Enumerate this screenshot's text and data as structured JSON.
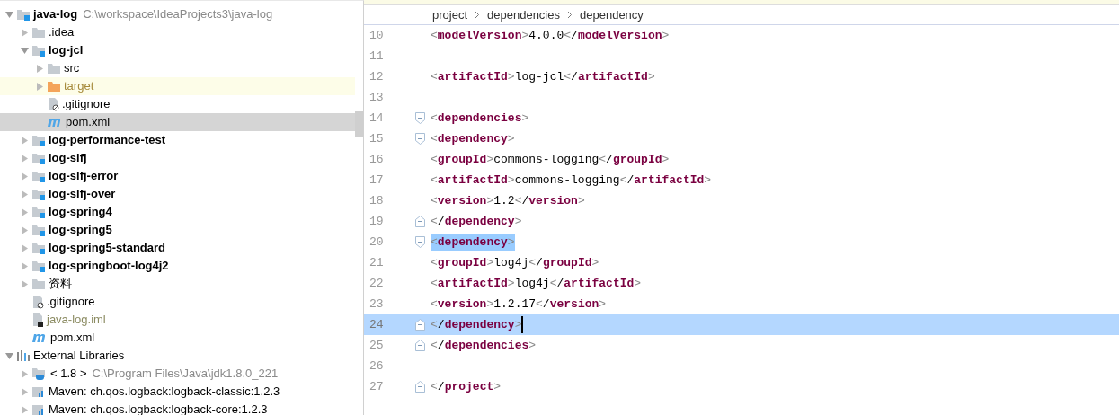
{
  "project_tree": [
    {
      "label": "java-log",
      "kind": "module",
      "bold": true,
      "path": "C:\\workspace\\IdeaProjects3\\java-log",
      "expanded": true,
      "selected": false,
      "children": [
        {
          "label": ".idea",
          "kind": "folder",
          "bold": false,
          "expanded": false,
          "selected": false
        },
        {
          "label": "log-jcl",
          "kind": "module",
          "bold": true,
          "expanded": true,
          "selected": false,
          "children": [
            {
              "label": "src",
              "kind": "folder",
              "bold": false,
              "expanded": false,
              "selected": false
            },
            {
              "label": "target",
              "kind": "excluded-folder",
              "bold": false,
              "expanded": false,
              "selected": false,
              "hovered": true
            },
            {
              "label": ".gitignore",
              "kind": "ignore-file",
              "bold": false,
              "selected": false
            },
            {
              "label": "pom.xml",
              "kind": "maven-file",
              "bold": false,
              "selected": true
            }
          ]
        },
        {
          "label": "log-performance-test",
          "kind": "module",
          "bold": true,
          "expanded": false,
          "selected": false
        },
        {
          "label": "log-slfj",
          "kind": "module",
          "bold": true,
          "expanded": false,
          "selected": false
        },
        {
          "label": "log-slfj-error",
          "kind": "module",
          "bold": true,
          "expanded": false,
          "selected": false
        },
        {
          "label": "log-slfj-over",
          "kind": "module",
          "bold": true,
          "expanded": false,
          "selected": false
        },
        {
          "label": "log-spring4",
          "kind": "module",
          "bold": true,
          "expanded": false,
          "selected": false
        },
        {
          "label": "log-spring5",
          "kind": "module",
          "bold": true,
          "expanded": false,
          "selected": false
        },
        {
          "label": "log-spring5-standard",
          "kind": "module",
          "bold": true,
          "expanded": false,
          "selected": false
        },
        {
          "label": "log-springboot-log4j2",
          "kind": "module",
          "bold": true,
          "expanded": false,
          "selected": false
        },
        {
          "label": "资料",
          "kind": "folder",
          "bold": false,
          "expanded": false,
          "selected": false
        },
        {
          "label": ".gitignore",
          "kind": "ignore-file",
          "bold": false,
          "selected": false
        },
        {
          "label": "java-log.iml",
          "kind": "iml-file",
          "bold": false,
          "selected": false
        },
        {
          "label": "pom.xml",
          "kind": "maven-file",
          "bold": false,
          "selected": false
        }
      ]
    },
    {
      "label": "External Libraries",
      "kind": "libraries",
      "bold": false,
      "expanded": true,
      "selected": false,
      "children": [
        {
          "label": "< 1.8 >",
          "kind": "jdk",
          "bold": false,
          "path": "C:\\Program Files\\Java\\jdk1.8.0_221",
          "expanded": false,
          "selected": false
        },
        {
          "label": "Maven: ch.qos.logback:logback-classic:1.2.3",
          "kind": "library",
          "bold": false,
          "expanded": false,
          "selected": false
        },
        {
          "label": "Maven: ch.qos.logback:logback-core:1.2.3",
          "kind": "library",
          "bold": false,
          "expanded": false,
          "selected": false
        }
      ]
    }
  ],
  "breadcrumb": [
    "project",
    "dependencies",
    "dependency"
  ],
  "editor_lines": [
    {
      "number": "10",
      "code": "    <modelVersion>4.0.0</modelVersion>",
      "current": false
    },
    {
      "number": "11",
      "current": false
    },
    {
      "number": "12",
      "code": "    <artifactId>log-jcl</artifactId>",
      "current": false
    },
    {
      "number": "13",
      "current": false
    },
    {
      "number": "14",
      "code": "    <dependencies>",
      "fold_open": true,
      "current": false
    },
    {
      "number": "15",
      "code": "        <dependency>",
      "fold_open": true,
      "current": false
    },
    {
      "number": "16",
      "code": "            <groupId>commons-logging</groupId>",
      "current": false
    },
    {
      "number": "17",
      "code": "            <artifactId>commons-logging</artifactId>",
      "current": false
    },
    {
      "number": "18",
      "code": "            <version>1.2</version>",
      "current": false
    },
    {
      "number": "19",
      "code": "        </dependency>",
      "fold_close": true,
      "current": false
    },
    {
      "number": "20",
      "code": "        <dependency>",
      "fold_open": true,
      "current": false,
      "match_highlight": true
    },
    {
      "number": "21",
      "code": "            <groupId>log4j</groupId>",
      "current": false
    },
    {
      "number": "22",
      "code": "            <artifactId>log4j</artifactId>",
      "current": false
    },
    {
      "number": "23",
      "code": "            <version>1.2.17</version>",
      "current": false
    },
    {
      "number": "24",
      "code": "        </dependency>",
      "fold_close": true,
      "current": true,
      "caret": true
    },
    {
      "number": "25",
      "code": "    </dependencies>",
      "fold_close": true,
      "current": false
    },
    {
      "number": "26",
      "current": false
    },
    {
      "number": "27",
      "code": "</project>",
      "fold_close": true,
      "current": false
    }
  ]
}
